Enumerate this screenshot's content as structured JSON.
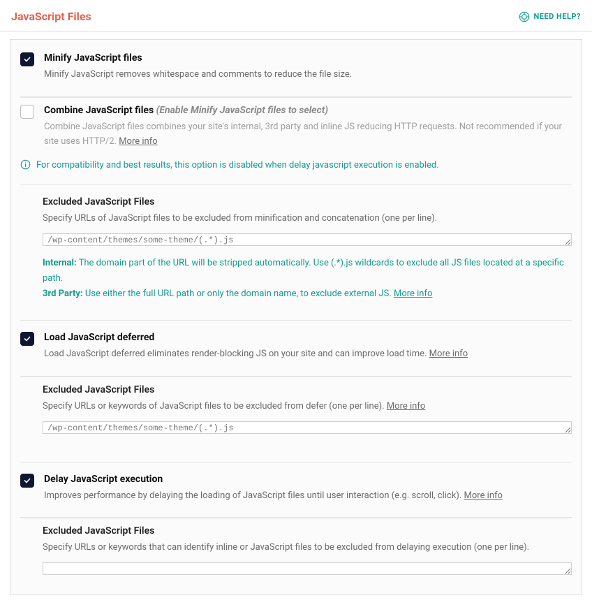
{
  "header": {
    "title": "JavaScript Files",
    "help": "NEED HELP?"
  },
  "minify": {
    "title": "Minify JavaScript files",
    "desc": "Minify JavaScript removes whitespace and comments to reduce the file size."
  },
  "combine": {
    "title": "Combine JavaScript files",
    "aside": "(Enable Minify JavaScript files to select)",
    "desc": "Combine JavaScript files combines your site's internal, 3rd party and inline JS reducing HTTP requests. Not recommended if your site uses HTTP/2. ",
    "more": "More info",
    "notice": "For compatibility and best results, this option is disabled when delay javascript execution is enabled."
  },
  "excluded_minify": {
    "heading": "Excluded JavaScript Files",
    "desc": "Specify URLs of JavaScript files to be excluded from minification and concatenation (one per line).",
    "placeholder": "/wp-content/themes/some-theme/(.*).js",
    "hint_internal_label": "Internal:",
    "hint_internal": " The domain part of the URL will be stripped automatically. Use (.*).js wildcards to exclude all JS files located at a specific path.",
    "hint_3p_label": "3rd Party:",
    "hint_3p": " Use either the full URL path or only the domain name, to exclude external JS. ",
    "more": "More info"
  },
  "defer": {
    "title": "Load JavaScript deferred",
    "desc": "Load JavaScript deferred eliminates render-blocking JS on your site and can improve load time. ",
    "more": "More info"
  },
  "excluded_defer": {
    "heading": "Excluded JavaScript Files",
    "desc": "Specify URLs or keywords of JavaScript files to be excluded from defer (one per line). ",
    "more": "More info",
    "placeholder": "/wp-content/themes/some-theme/(.*).js"
  },
  "delay": {
    "title": "Delay JavaScript execution",
    "desc": "Improves performance by delaying the loading of JavaScript files until user interaction (e.g. scroll, click). ",
    "more": "More info"
  },
  "excluded_delay": {
    "heading": "Excluded JavaScript Files",
    "desc": "Specify URLs or keywords that can identify inline or JavaScript files to be excluded from delaying execution (one per line)."
  }
}
